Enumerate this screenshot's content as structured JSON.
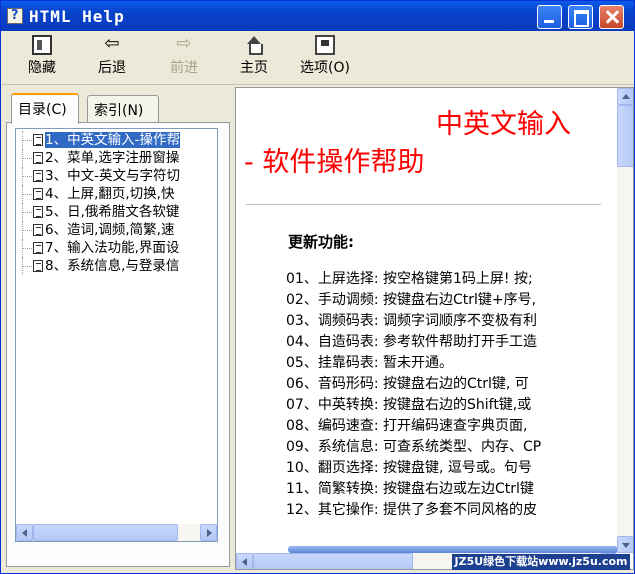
{
  "window": {
    "title": "HTML Help"
  },
  "toolbar": {
    "hide": "隐藏",
    "back": "后退",
    "forward": "前进",
    "home": "主页",
    "options": "选项(O)"
  },
  "tabs": {
    "contents": "目录(C)",
    "index": "索引(N)"
  },
  "tree": [
    "1、中英文输入-操作帮",
    "2、菜单,选字注册窗操",
    "3、中文-英文与字符切",
    "4、上屏,翻页,切换,快",
    "5、日,俄希腊文各软键",
    "6、造词,调频,简繁,速",
    "7、输入法功能,界面设",
    "8、系统信息,与登录信"
  ],
  "content": {
    "heading_line1": "中英文输入",
    "heading_line2": "- 软件操作帮助",
    "new_features": "更新功能:",
    "features": [
      "01、上屏选择: 按空格键第1码上屏! 按;",
      "02、手动调频: 按键盘右边Ctrl键+序号,",
      "03、调频码表: 调频字词顺序不变极有利",
      "04、自造码表: 参考软件帮助打开手工造",
      "05、挂靠码表: 暂未开通。",
      "06、音码形码: 按键盘右边的Ctrl键, 可",
      "07、中英转换: 按键盘右边的Shift键,或",
      "08、编码速查: 打开编码速查字典页面,",
      "09、系统信息: 可查系统类型、内存、CP",
      "10、翻页选择: 按键盘键, 逗号或。句号",
      "11、简繁转换: 按键盘右边或左边Ctrl键",
      "12、其它操作: 提供了多套不同风格的皮"
    ]
  },
  "watermark": "JZ5U绿色下载站www.jz5u.com"
}
